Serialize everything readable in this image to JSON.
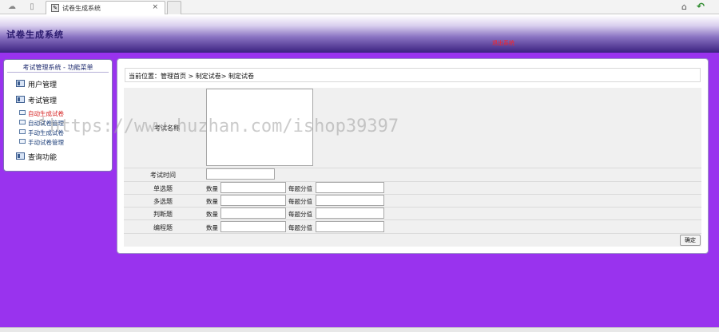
{
  "browser": {
    "tab_title": "试卷生成系统",
    "tab_close": "×"
  },
  "header": {
    "title": "试卷生成系统",
    "link": "退出系统"
  },
  "sidebar": {
    "title": "考试管理系统 - 功能菜单",
    "groups": [
      {
        "label": "用户管理"
      },
      {
        "label": "考试管理",
        "items": [
          "自动生成试卷",
          "自动试卷管理",
          "手动生成试卷",
          "手动试卷管理"
        ]
      },
      {
        "label": "查询功能"
      }
    ]
  },
  "main": {
    "breadcrumb": "当前位置：管理首页 > 制定试卷> 制定试卷",
    "form": {
      "exam_name_label": "考试名称",
      "exam_time_label": "考试时间",
      "quantity_label": "数量",
      "score_label": "每题分值",
      "question_types": [
        "单选题",
        "多选题",
        "判断题",
        "编程题"
      ],
      "confirm_label": "确定"
    }
  },
  "watermark": "https://www.huzhan.com/ishop39397"
}
